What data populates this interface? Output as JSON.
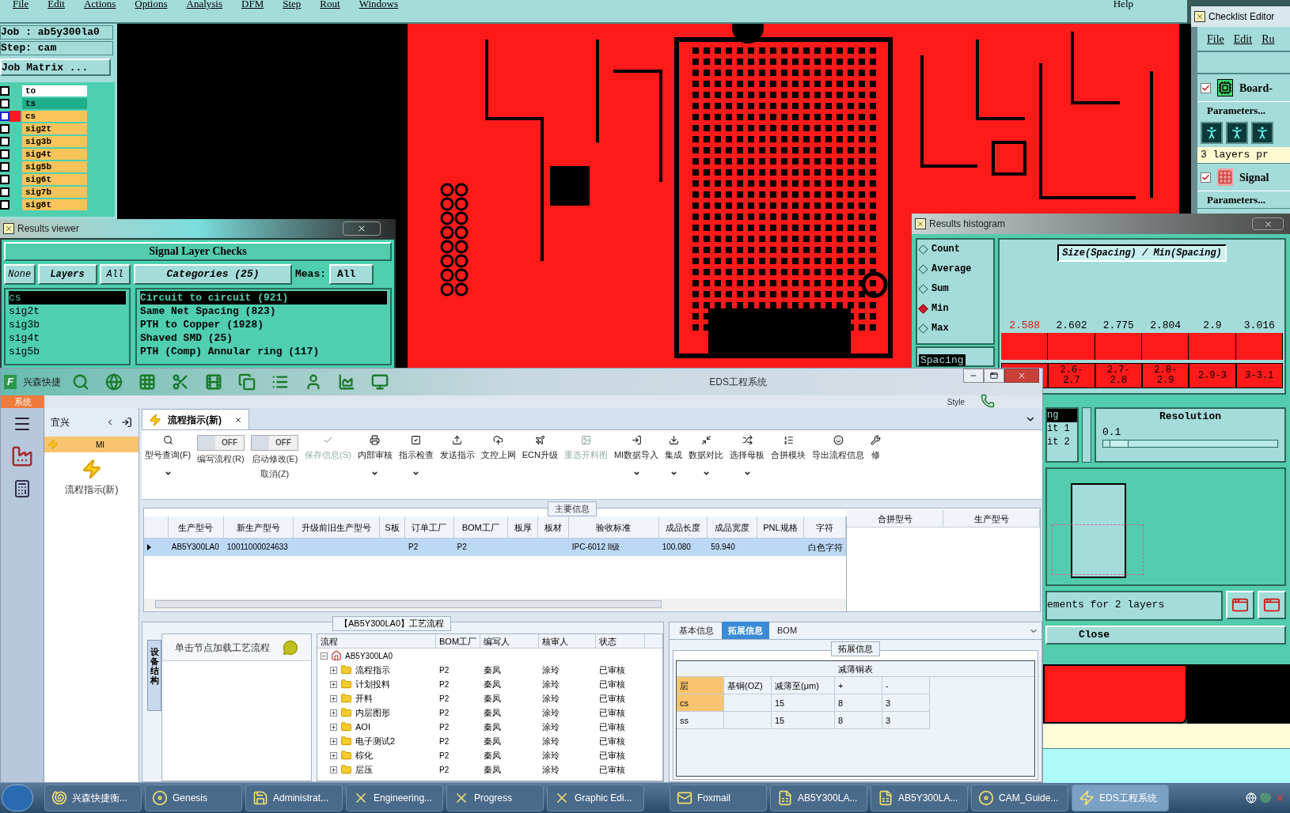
{
  "menu_bar": {
    "items": [
      "File",
      "Edit",
      "Actions",
      "Options",
      "Analysis",
      "DFM",
      "Step",
      "Rout",
      "Windows"
    ],
    "help": "Help"
  },
  "job_panel": {
    "job": "Job : ab5y300la0",
    "step": "Step: cam",
    "matrix_button": "Job Matrix ...",
    "layers": [
      {
        "name": "to",
        "color": "#ffffff",
        "active": false,
        "checked": false
      },
      {
        "name": "ts",
        "color": "#1fae8c",
        "active": false,
        "checked": false
      },
      {
        "name": "cs",
        "color": "#f8c45a",
        "active": true,
        "checked": false
      },
      {
        "name": "sig2t",
        "color": "#f8c45a",
        "active": false,
        "checked": false
      },
      {
        "name": "sig3b",
        "color": "#f8c45a",
        "active": false,
        "checked": false
      },
      {
        "name": "sig4t",
        "color": "#f8c45a",
        "active": false,
        "checked": false
      },
      {
        "name": "sig5b",
        "color": "#f8c45a",
        "active": false,
        "checked": false
      },
      {
        "name": "sig6t",
        "color": "#f8c45a",
        "active": false,
        "checked": false
      },
      {
        "name": "sig7b",
        "color": "#f8c45a",
        "active": false,
        "checked": false
      },
      {
        "name": "sig8t",
        "color": "#f8c45a",
        "active": false,
        "checked": false
      }
    ]
  },
  "checklist_editor": {
    "title": "Checklist Editor",
    "menu": [
      "File",
      "Edit",
      "Ru"
    ],
    "checks": [
      {
        "label": "Board-",
        "checked": true,
        "button": "Parameters..."
      },
      {
        "label": "Signal",
        "checked": true,
        "button": "Parameters..."
      }
    ],
    "status": "3 layers pr"
  },
  "results_viewer": {
    "title": "Results viewer",
    "heading": "Signal Layer Checks",
    "filter_buttons": [
      "None",
      "Layers",
      "All"
    ],
    "categories_button": "Categories (25)",
    "meas_label": "Meas:",
    "meas_value": "All",
    "layers": [
      {
        "name": "cs",
        "selected": true
      },
      {
        "name": "sig2t",
        "selected": false
      },
      {
        "name": "sig3b",
        "selected": false
      },
      {
        "name": "sig4t",
        "selected": false
      },
      {
        "name": "sig5b",
        "selected": false
      }
    ],
    "categories": [
      {
        "label": "Circuit to circuit (921)",
        "selected": true
      },
      {
        "label": "Same Net Spacing (823)",
        "selected": false
      },
      {
        "label": "PTH to Copper (1928)",
        "selected": false
      },
      {
        "label": "Shaved SMD (25)",
        "selected": false
      },
      {
        "label": "PTH (Comp) Annular ring (117)",
        "selected": false
      }
    ]
  },
  "histogram": {
    "title": "Results histogram",
    "modes": [
      {
        "label": "Count",
        "selected": false
      },
      {
        "label": "Average",
        "selected": false
      },
      {
        "label": "Sum",
        "selected": false
      },
      {
        "label": "Min",
        "selected": true
      },
      {
        "label": "Max",
        "selected": false
      }
    ],
    "measure": {
      "label": "Spacing",
      "selected": true
    },
    "chart_title": "Size(Spacing) / Min(Spacing)",
    "bins": [
      {
        "value": "2.588",
        "highlighted": true
      },
      {
        "value": "2.602",
        "range": "2.6-2.7",
        "highlighted": false
      },
      {
        "value": "2.775",
        "range": "2.7-2.8",
        "highlighted": false
      },
      {
        "value": "2.804",
        "range": "2.8-2.9",
        "highlighted": false
      },
      {
        "value": "2.9",
        "range": "2.9-3",
        "highlighted": false
      },
      {
        "value": "3.016",
        "range": "3-3.1",
        "highlighted": false
      }
    ],
    "limits": [
      {
        "label": "ng",
        "selected": true
      },
      {
        "label": "it 1",
        "selected": false
      },
      {
        "label": "it 2",
        "selected": false
      }
    ],
    "resolution_label": "Resolution",
    "resolution_value": "0.1",
    "resolution_slider": {
      "level": 0.04
    },
    "message": "ements for 2 layers",
    "close": "Close"
  },
  "eds": {
    "logo": "F",
    "title": "EDS工程系统",
    "brand": "兴森快捷",
    "system_tab": "系统",
    "style": "Style",
    "nav": {
      "site": "宜兴",
      "group": "MI",
      "item": "流程指示(新)"
    },
    "doc_tab": "流程指示(新)",
    "toolbar": [
      {
        "kind": "button",
        "label": "型号查询(F)",
        "dropdown": true,
        "disabled": false
      },
      {
        "kind": "toggle",
        "label": "编写流程(R)",
        "on": false,
        "text": "OFF"
      },
      {
        "kind": "toggle",
        "label": "启动修改(E)",
        "sublabel": "取消(Z)",
        "on": false,
        "text": "OFF"
      },
      {
        "kind": "button",
        "label": "保存信息(S)",
        "dropdown": false,
        "disabled": true
      },
      {
        "kind": "button",
        "label": "内部审核",
        "dropdown": true,
        "disabled": false
      },
      {
        "kind": "button",
        "label": "指示检查",
        "dropdown": true,
        "disabled": false
      },
      {
        "kind": "button",
        "label": "发送指示",
        "dropdown": false,
        "disabled": false
      },
      {
        "kind": "button",
        "label": "文控上网",
        "dropdown": false,
        "disabled": false
      },
      {
        "kind": "button",
        "label": "ECN升级",
        "dropdown": false,
        "disabled": false
      },
      {
        "kind": "button",
        "label": "重选开料图",
        "dropdown": false,
        "disabled": true
      },
      {
        "kind": "button",
        "label": "MI数据导入",
        "dropdown": true,
        "disabled": false
      },
      {
        "kind": "button",
        "label": "集成",
        "dropdown": true,
        "disabled": false
      },
      {
        "kind": "button",
        "label": "数据对比",
        "dropdown": true,
        "disabled": false
      },
      {
        "kind": "button",
        "label": "选择母板",
        "dropdown": true,
        "disabled": false
      },
      {
        "kind": "button",
        "label": "合拼模块",
        "dropdown": false,
        "disabled": false
      },
      {
        "kind": "button",
        "label": "导出流程信息",
        "dropdown": false,
        "disabled": false
      },
      {
        "kind": "button",
        "label": "修",
        "dropdown": false,
        "disabled": false
      }
    ],
    "main_info": {
      "legend": "主要信息",
      "columns": [
        "生产型号",
        "新生产型号",
        "升级前旧生产型号",
        "S板",
        "订单工厂",
        "BOM工厂",
        "板厚",
        "板材",
        "验收标准",
        "成品长度",
        "成品宽度",
        "PNL规格",
        "字符"
      ],
      "rows": [
        {
          "selected": true,
          "cells": [
            "AB5Y300LA0",
            "10011000024633",
            "",
            "",
            "P2",
            "P2",
            "",
            "",
            "IPC-6012 II级",
            "100.080",
            "59.940",
            "",
            "白色字符"
          ]
        }
      ],
      "side_columns": [
        "合拼型号",
        "生产型号"
      ]
    },
    "process": {
      "legend": "【AB5Y300LA0】工艺流程",
      "side_tab": "设备结构",
      "hint": "单击节点加载工艺流程",
      "columns": [
        "流程",
        "BOM工厂",
        "编写人",
        "核审人",
        "状态"
      ],
      "root": "AB5Y300LA0",
      "rows": [
        {
          "name": "流程指示",
          "bom": "P2",
          "writer": "秦凤",
          "reviewer": "涂玲",
          "status": "已审核"
        },
        {
          "name": "计划投料",
          "bom": "P2",
          "writer": "秦凤",
          "reviewer": "涂玲",
          "status": "已审核"
        },
        {
          "name": "开料",
          "bom": "P2",
          "writer": "秦凤",
          "reviewer": "涂玲",
          "status": "已审核"
        },
        {
          "name": "内层图形",
          "bom": "P2",
          "writer": "秦凤",
          "reviewer": "涂玲",
          "status": "已审核"
        },
        {
          "name": "AOI",
          "bom": "P2",
          "writer": "秦凤",
          "reviewer": "涂玲",
          "status": "已审核"
        },
        {
          "name": "电子测试2",
          "bom": "P2",
          "writer": "秦凤",
          "reviewer": "涂玲",
          "status": "已审核"
        },
        {
          "name": "棕化",
          "bom": "P2",
          "writer": "秦凤",
          "reviewer": "涂玲",
          "status": "已审核"
        },
        {
          "name": "层压",
          "bom": "P2",
          "writer": "秦凤",
          "reviewer": "涂玲",
          "status": "已审核"
        }
      ]
    },
    "ext_info": {
      "tabs": [
        {
          "label": "基本信息",
          "selected": false
        },
        {
          "label": "拓展信息",
          "selected": true
        },
        {
          "label": "BOM",
          "selected": false
        }
      ],
      "legend": "拓展信息",
      "table_title": "减薄铜表",
      "columns": [
        "层",
        "基铜(OZ)",
        "减薄至(μm)",
        "+",
        "-"
      ],
      "rows": [
        {
          "selected": true,
          "cells": [
            "cs",
            "",
            "15",
            "8",
            "3"
          ]
        },
        {
          "selected": false,
          "cells": [
            "ss",
            "",
            "15",
            "8",
            "3"
          ]
        }
      ]
    }
  },
  "taskbar": {
    "items": [
      {
        "label": "兴森快捷衡...",
        "selected": false
      },
      {
        "label": "Genesis",
        "selected": false
      },
      {
        "label": "Administrat...",
        "selected": false
      },
      {
        "label": "Engineering...",
        "selected": false
      },
      {
        "label": "Progress",
        "selected": false
      },
      {
        "label": "Graphic Edi...",
        "selected": false
      },
      {
        "label": "Foxmail",
        "selected": false
      },
      {
        "label": "AB5Y300LA...",
        "selected": false
      },
      {
        "label": "AB5Y300LA...",
        "selected": false
      },
      {
        "label": "CAM_Guide...",
        "selected": false
      },
      {
        "label": "EDS工程系统",
        "selected": true
      }
    ]
  }
}
